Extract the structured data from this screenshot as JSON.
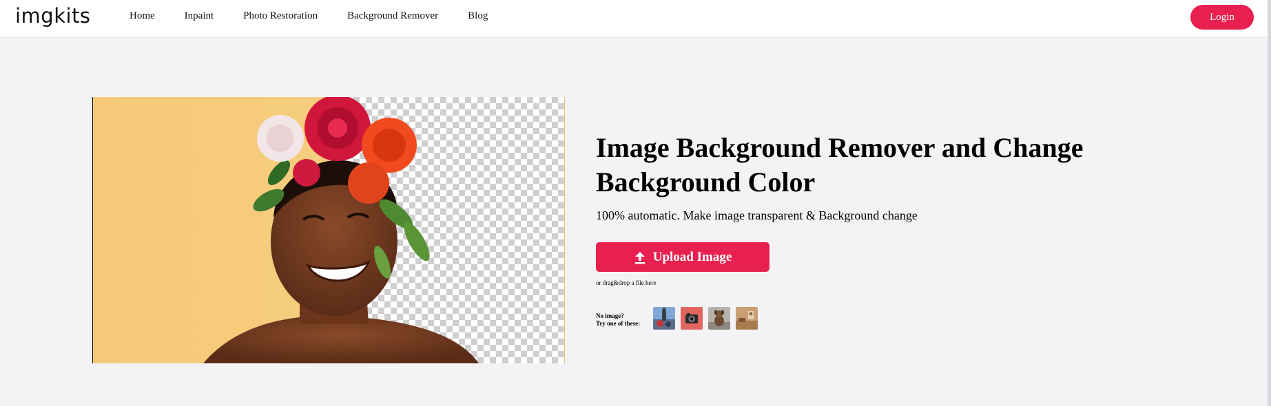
{
  "header": {
    "logo": "imgkits",
    "nav": [
      "Home",
      "Inpaint",
      "Photo Restoration",
      "Background Remover",
      "Blog"
    ],
    "login_label": "Login"
  },
  "hero": {
    "title": "Image Background Remover and Change Background Color",
    "subtitle": "100% automatic. Make image transparent & Background change",
    "upload_label": "Upload Image",
    "drag_hint": "or drag&drop a file here",
    "sample_line1": "No image?",
    "sample_line2": "Try one of these:"
  },
  "colors": {
    "accent": "#e8204f",
    "background": "#f3f3f6",
    "header_bg": "#ffffff"
  },
  "icons": {
    "upload": "upload-arrow-icon"
  }
}
